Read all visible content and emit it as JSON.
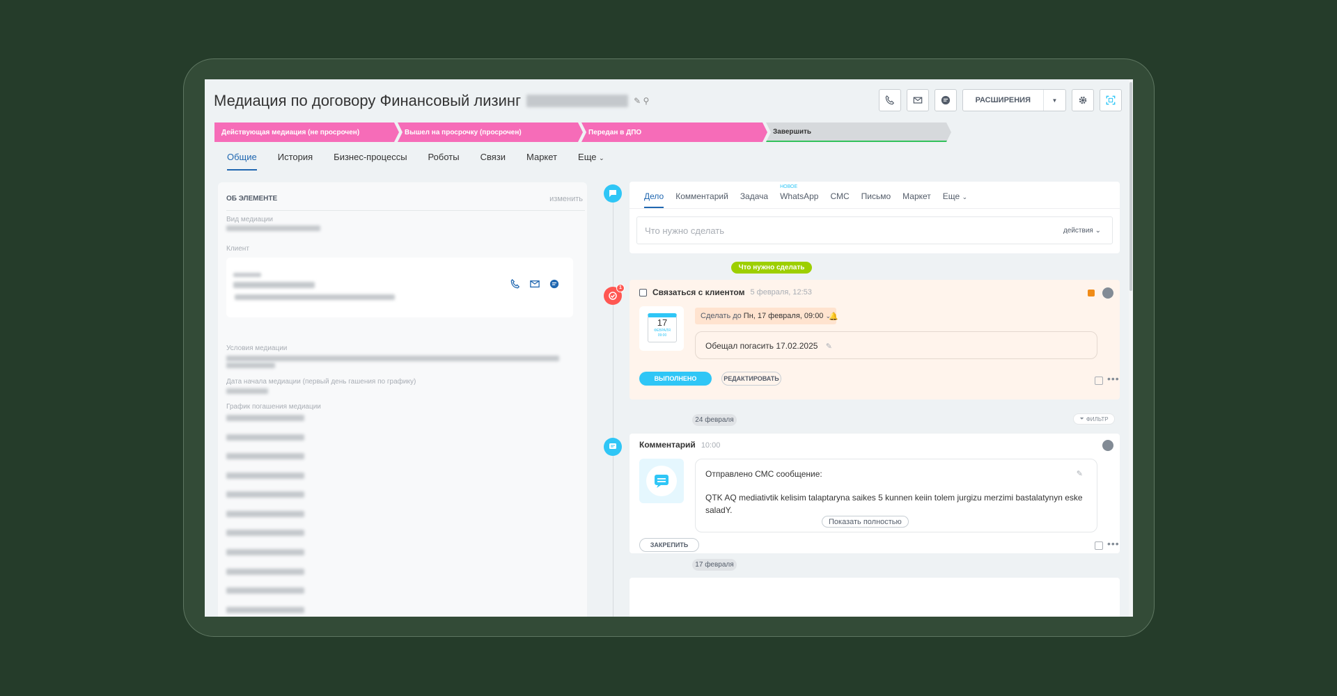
{
  "header": {
    "title": "Медиация по договору Финансовый лизинг",
    "extensions_label": "РАСШИРЕНИЯ"
  },
  "stages": [
    {
      "label": "Действующая медиация (не просрочен)",
      "color": "#f66cb8"
    },
    {
      "label": "Вышел на просрочку (просрочен)",
      "color": "#f66cb8"
    },
    {
      "label": "Передан в ДПО",
      "color": "#f66cb8"
    },
    {
      "label": "Завершить",
      "color": "#d6d9dc"
    }
  ],
  "tabs": [
    "Общие",
    "История",
    "Бизнес-процессы",
    "Роботы",
    "Связи",
    "Маркет",
    "Еще"
  ],
  "about": {
    "title": "ОБ ЭЛЕМЕНТЕ",
    "edit": "изменить",
    "fields": {
      "mediation_type": "Вид медиации",
      "client": "Клиент",
      "conditions": "Условия медиации",
      "start_date": "Дата начала медиации (первый день гашения по графику)",
      "schedule": "График погашения медиации"
    }
  },
  "editor": {
    "tabs": [
      "Дело",
      "Комментарий",
      "Задача",
      "WhatsApp",
      "СМС",
      "Письмо",
      "Маркет",
      "Еще"
    ],
    "new_badge": "НОВОЕ",
    "placeholder": "Что нужно сделать",
    "actions": "действия"
  },
  "todo_pill": "Что нужно сделать",
  "task": {
    "title": "Связаться с клиентом",
    "date": "5 февраля, 12:53",
    "badge_count": "1",
    "calendar_day": "17",
    "calendar_month": "ФЕВРАЛЯ",
    "calendar_time": "09:00",
    "deadline_prefix": "Сделать до",
    "deadline_value": "Пн, 17 февраля, 09:00",
    "note": "Обещал погасить 17.02.2025",
    "done_label": "ВЫПОЛНЕНО",
    "edit_label": "РЕДАКТИРОВАТЬ"
  },
  "date_sep_1": "24 февраля",
  "filter_label": "ФИЛЬТР",
  "comment": {
    "title": "Комментарий",
    "time": "10:00",
    "line1": "Отправлено СМС сообщение:",
    "line2": "QTK AQ mediativtik kelisim talaptaryna saikes 5 kunnen keiin tolem jurgizu merzimi bastalatynyn eske saladY.",
    "show_all": "Показать полностью",
    "pin_label": "ЗАКРЕПИТЬ"
  },
  "date_sep_2": "17 февраля"
}
